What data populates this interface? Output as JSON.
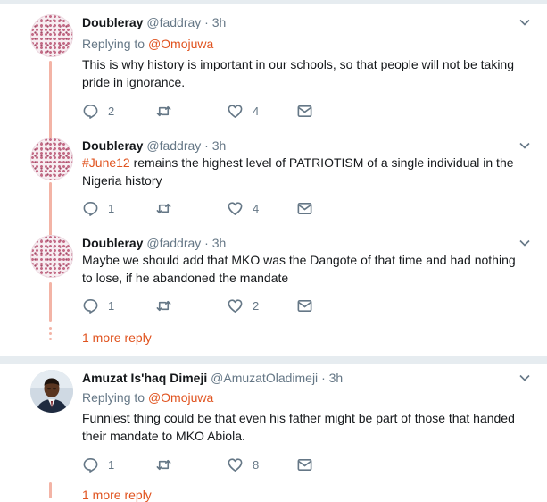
{
  "tweets": [
    {
      "name": "Doubleray",
      "handle": "@faddray",
      "time": "· 3h",
      "replying_prefix": "Replying to ",
      "replying_to": "@Omojuwa",
      "hashtag": "",
      "text": "This is why history is important in our schools, so that people will not be taking pride in ignorance.",
      "reply_count": "2",
      "retweet_count": "",
      "like_count": "4"
    },
    {
      "name": "Doubleray",
      "handle": "@faddray",
      "time": "· 3h",
      "replying_prefix": "",
      "replying_to": "",
      "hashtag": "#June12",
      "text": " remains the highest level of PATRIOTISM of a single individual in the Nigeria history",
      "reply_count": "1",
      "retweet_count": "",
      "like_count": "4"
    },
    {
      "name": "Doubleray",
      "handle": "@faddray",
      "time": "· 3h",
      "replying_prefix": "",
      "replying_to": "",
      "hashtag": "",
      "text": "Maybe we should add that MKO was the Dangote of that time and had nothing to lose, if he abandoned the mandate",
      "reply_count": "1",
      "retweet_count": "",
      "like_count": "2"
    },
    {
      "name": "Amuzat Is'haq Dimeji",
      "handle": "@AmuzatOladimeji",
      "time": "· 3h",
      "replying_prefix": "Replying to ",
      "replying_to": "@Omojuwa",
      "hashtag": "",
      "text": "Funniest thing could be that even his father might be part of those that handed their mandate to MKO Abiola.",
      "reply_count": "1",
      "retweet_count": "",
      "like_count": "8"
    }
  ],
  "more_replies": [
    "1 more reply",
    "1 more reply"
  ],
  "icons": [
    "reply-icon",
    "retweet-icon",
    "like-icon",
    "message-icon",
    "chevron-down-icon"
  ],
  "colors": {
    "accent": "#e0531f",
    "muted": "#657786",
    "thread": "#f3b4a6",
    "separator": "#e6ecf0"
  }
}
